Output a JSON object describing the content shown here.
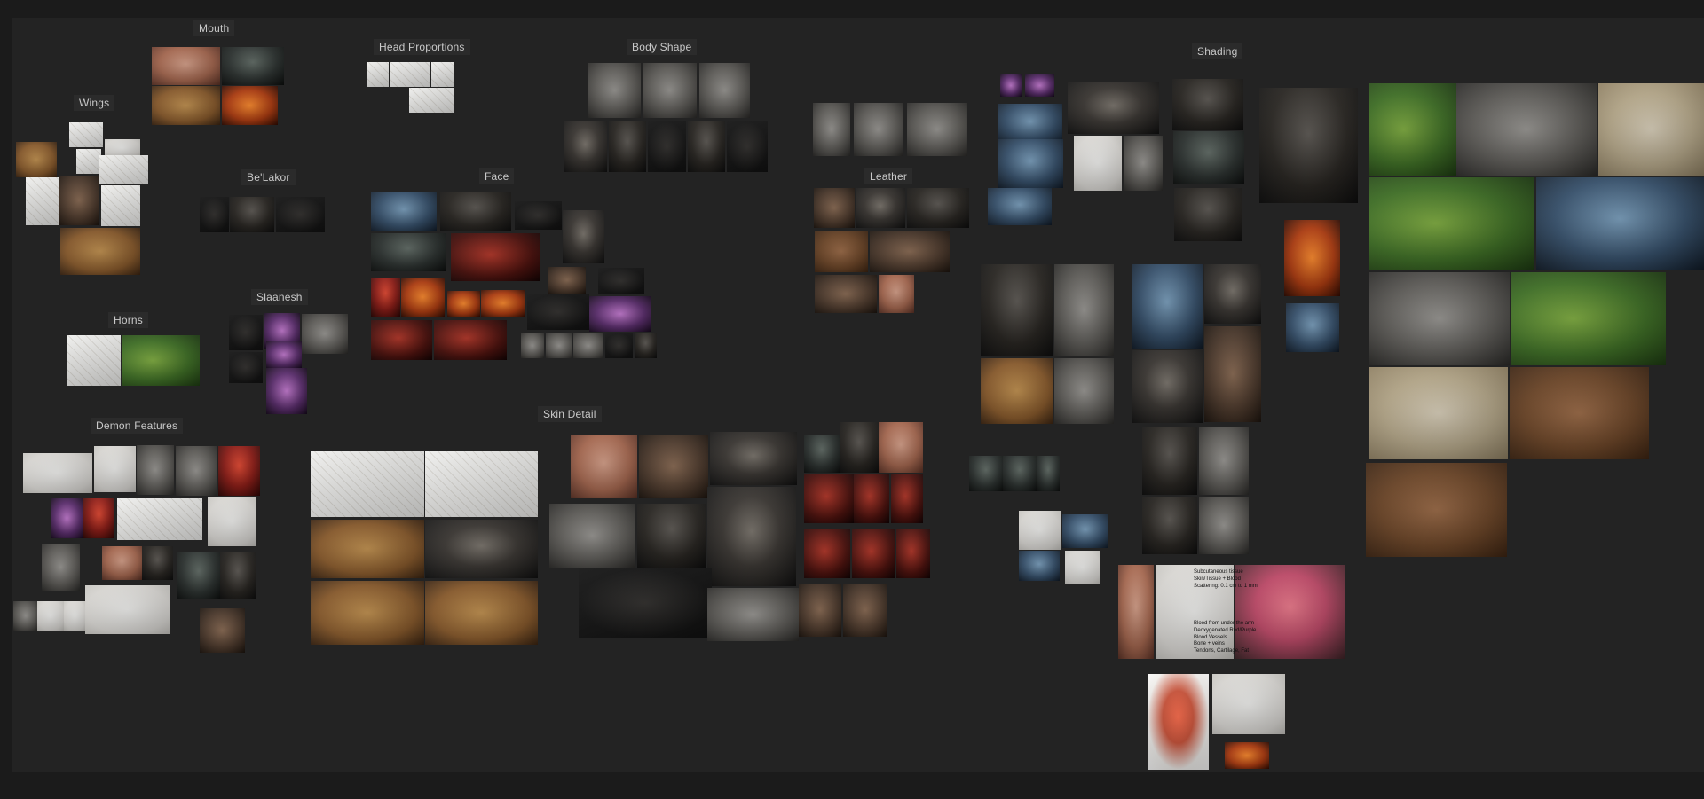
{
  "board": {
    "background": "#232323",
    "labels": {
      "mouth": "Mouth",
      "wings": "Wings",
      "head_proportions": "Head Proportions",
      "body_shape": "Body Shape",
      "belakor": "Be'Lakor",
      "face": "Face",
      "leather": "Leather",
      "slaanesh": "Slaanesh",
      "horns": "Horns",
      "demon_features": "Demon Features",
      "skin_detail": "Skin Detail",
      "shading": "Shading"
    },
    "anatomy_notes": [
      "Subcutaneous tissue\nSkin/Tissue + Blood\nScattering: 0.1 cm to 1 mm",
      "Blood from under the arm\nDeoxygenated Red/Purple\nBlood Vessels\nBone + veins\nTendons, Cartilage, Fat"
    ]
  }
}
